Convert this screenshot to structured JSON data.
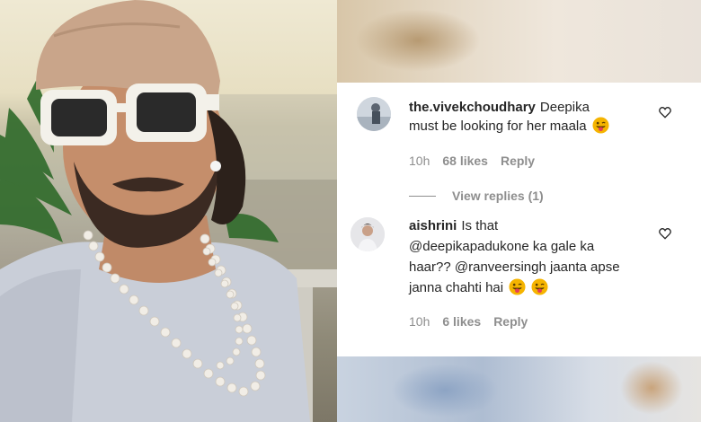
{
  "colors": {
    "text": "#262626",
    "muted": "#8e8e8e",
    "emoji_face": "#f5b400",
    "emoji_tongue": "#e53e58"
  },
  "photo": {
    "subject": "selfie-with-cap-white-sunglasses-pearl-necklace"
  },
  "comments": [
    {
      "username": "the.vivekchoudhary",
      "text": "Deepika",
      "text_line2": "must be looking for her maala",
      "emoji": "tongue-wink-emoji",
      "time": "10h",
      "likes": "68 likes",
      "reply": "Reply"
    },
    {
      "username": "aishrini",
      "text": "Is that",
      "text_line2": "@deepikapadukone ka gale ka",
      "text_line3": "haar?? @ranveersingh jaanta apse",
      "text_line4": "janna chahti hai",
      "emoji": "tongue-wink-emoji",
      "emoji_count": 2,
      "time": "10h",
      "likes": "6 likes",
      "reply": "Reply"
    }
  ],
  "view_replies": "View replies (1)"
}
